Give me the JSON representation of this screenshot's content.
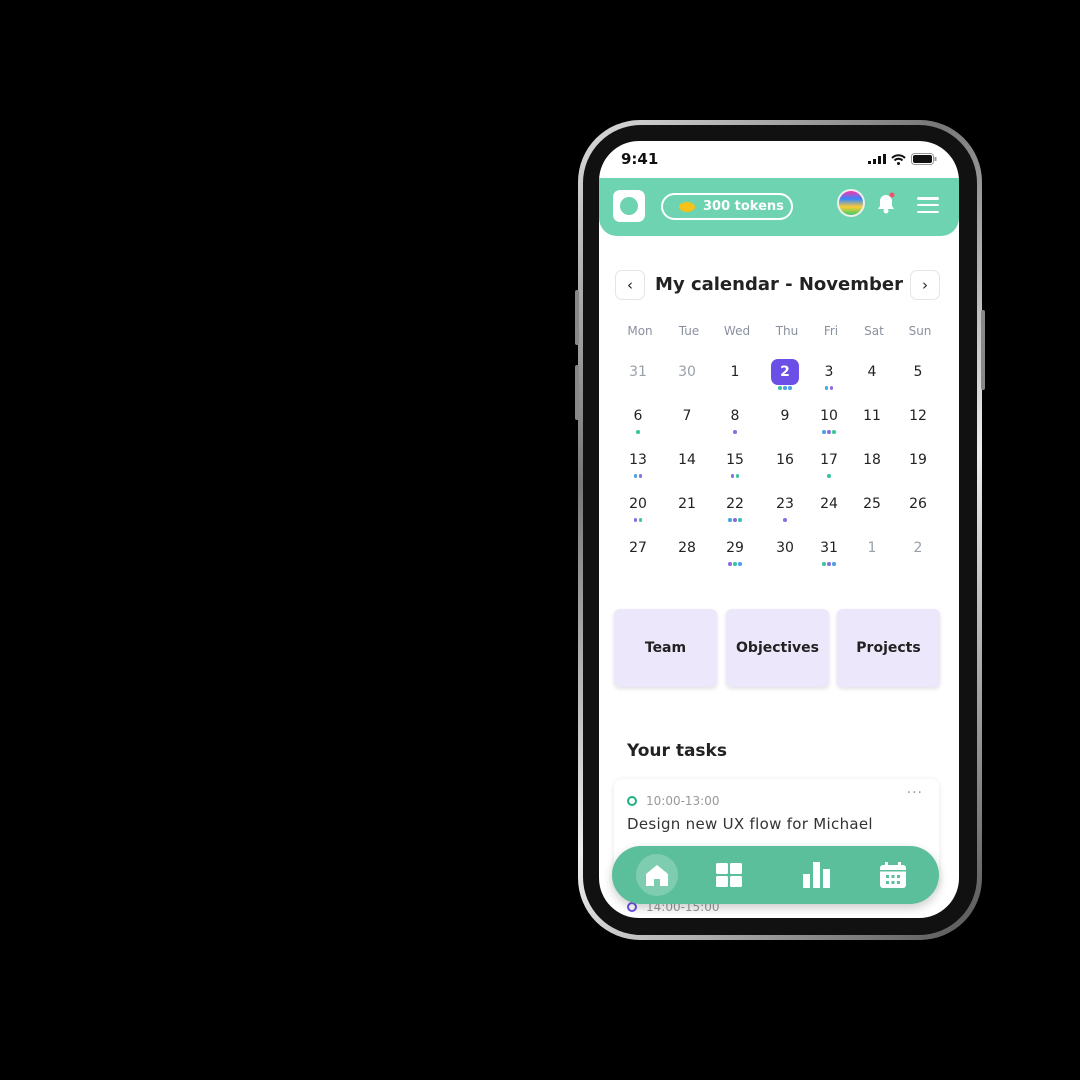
{
  "status": {
    "time": "9:41"
  },
  "header": {
    "tokens": "300 tokens"
  },
  "calendar": {
    "title": "My calendar - November",
    "weekdays": [
      "Mon",
      "Tue",
      "Wed",
      "Thu",
      "Fri",
      "Sat",
      "Sun"
    ],
    "selected_day": "2",
    "dot_colors": {
      "t": "#3cc4a0",
      "b": "#4aa3e8",
      "p": "#8a6fe0"
    },
    "weeks": [
      [
        {
          "d": "31",
          "m": true
        },
        {
          "d": "30",
          "m": true
        },
        {
          "d": "1"
        },
        {
          "d": "2",
          "dots": "tbb"
        },
        {
          "d": "3",
          "dots": "bp"
        },
        {
          "d": "4"
        },
        {
          "d": "5"
        }
      ],
      [
        {
          "d": "6",
          "dots": "t"
        },
        {
          "d": "7"
        },
        {
          "d": "8",
          "dots": "p"
        },
        {
          "d": "9"
        },
        {
          "d": "10",
          "dots": "bpt"
        },
        {
          "d": "11"
        },
        {
          "d": "12"
        }
      ],
      [
        {
          "d": "13",
          "dots": "bp"
        },
        {
          "d": "14"
        },
        {
          "d": "15",
          "dots": "pt"
        },
        {
          "d": "16"
        },
        {
          "d": "17",
          "dots": "t"
        },
        {
          "d": "18"
        },
        {
          "d": "19"
        }
      ],
      [
        {
          "d": "20",
          "dots": "pt"
        },
        {
          "d": "21"
        },
        {
          "d": "22",
          "dots": "bpt"
        },
        {
          "d": "23",
          "dots": "p"
        },
        {
          "d": "24"
        },
        {
          "d": "25"
        },
        {
          "d": "26"
        }
      ],
      [
        {
          "d": "27"
        },
        {
          "d": "28"
        },
        {
          "d": "29",
          "dots": "ptb"
        },
        {
          "d": "30"
        },
        {
          "d": "31",
          "dots": "tpb"
        },
        {
          "d": "1",
          "m": true
        },
        {
          "d": "2",
          "m": true
        }
      ]
    ]
  },
  "shortcuts": [
    "Team",
    "Objectives",
    "Projects"
  ],
  "tasks": {
    "heading": "Your tasks",
    "items": [
      {
        "time": "10:00-13:00",
        "title": "Design new UX flow for Michael",
        "color": "#20b080"
      },
      {
        "time": "14:00-15:00",
        "color": "#6b4fe6"
      }
    ]
  },
  "nav": [
    "home-icon",
    "grid-icon",
    "chart-icon",
    "calendar-icon"
  ],
  "colors": {
    "header": "#6dd3b0",
    "accent": "#6b4fe6",
    "nav": "#5cbf9c"
  }
}
